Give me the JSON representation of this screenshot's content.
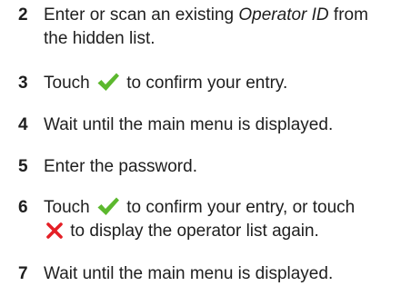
{
  "steps": [
    {
      "number": "2",
      "line1_before": "Enter or scan an existing ",
      "line1_emphasis": "Operator ID",
      "line1_after": " from",
      "line2": "the hidden list."
    },
    {
      "number": "3",
      "before_icon": "Touch ",
      "icon": "checkmark-icon",
      "after_icon": " to confirm your entry."
    },
    {
      "number": "4",
      "text": "Wait until the main menu is displayed."
    },
    {
      "number": "5",
      "text": "Enter the password."
    },
    {
      "number": "6",
      "before_icon": "Touch ",
      "icon": "checkmark-icon",
      "after_icon": " to confirm your entry, or touch",
      "line2_icon": "cross-icon",
      "line2_after": " to display the operator list again."
    },
    {
      "number": "7",
      "text": "Wait until the main menu is displayed."
    }
  ],
  "colors": {
    "text": "#1e1e1e",
    "checkmark": "#5cb82e",
    "cross": "#e41f26"
  }
}
